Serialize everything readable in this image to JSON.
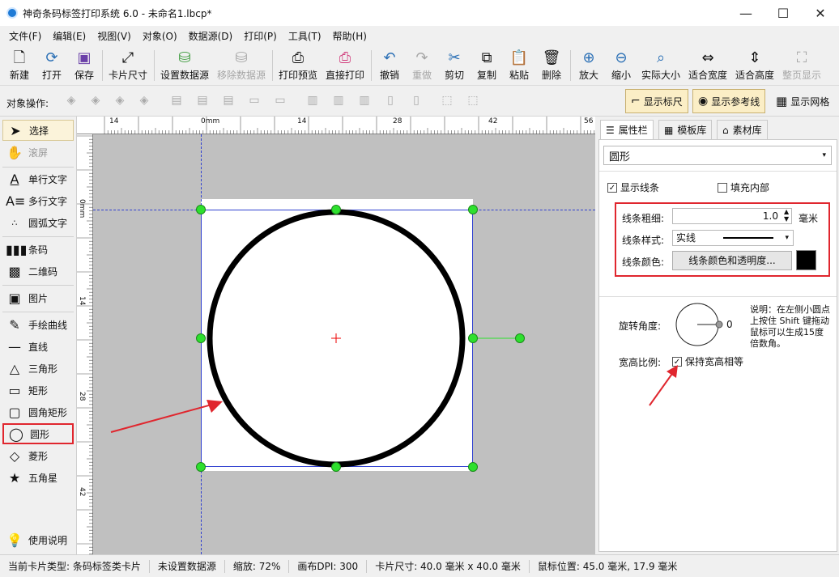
{
  "window": {
    "title": "神奇条码标签打印系统 6.0 - 未命名1.lbcp*"
  },
  "menu": [
    "文件(F)",
    "编辑(E)",
    "视图(V)",
    "对象(O)",
    "数据源(D)",
    "打印(P)",
    "工具(T)",
    "帮助(H)"
  ],
  "toolbar": {
    "new": "新建",
    "open": "打开",
    "save": "保存",
    "card_size": "卡片尺寸",
    "set_datasource": "设置数据源",
    "remove_datasource": "移除数据源",
    "print_preview": "打印预览",
    "direct_print": "直接打印",
    "undo": "撤销",
    "redo": "重做",
    "cut": "剪切",
    "copy": "复制",
    "paste": "粘贴",
    "delete": "删除",
    "zoom_in": "放大",
    "zoom_out": "缩小",
    "actual_size": "实际大小",
    "fit_width": "适合宽度",
    "fit_height": "适合高度",
    "full_page": "整页显示"
  },
  "objbar": {
    "label": "对象操作:",
    "show_ruler": "显示标尺",
    "show_guides": "显示参考线",
    "show_grid": "显示网格"
  },
  "tools": {
    "select": "选择",
    "scroll": "滚屏",
    "single_text": "单行文字",
    "multi_text": "多行文字",
    "arc_text": "圆弧文字",
    "barcode": "条码",
    "qrcode": "二维码",
    "image": "图片",
    "freehand": "手绘曲线",
    "line": "直线",
    "triangle": "三角形",
    "rect": "矩形",
    "round_rect": "圆角矩形",
    "circle": "圆形",
    "diamond": "菱形",
    "star": "五角星",
    "help": "使用说明"
  },
  "ruler": {
    "top": [
      "14",
      "0mm",
      "14",
      "28",
      "42",
      "56"
    ],
    "left": [
      "0mm",
      "14",
      "28",
      "42"
    ]
  },
  "panel": {
    "tabs": {
      "props": "属性栏",
      "templates": "模板库",
      "assets": "素材库"
    },
    "object_type": "圆形",
    "show_line": "显示线条",
    "fill_inside": "填充内部",
    "line_width_label": "线条粗细:",
    "line_width_value": "1.0",
    "line_width_unit": "毫米",
    "line_style_label": "线条样式:",
    "line_style_value": "实线",
    "line_color_label": "线条颜色:",
    "line_color_button": "线条颜色和透明度...",
    "line_color": "#000000",
    "rotation_label": "旋转角度:",
    "rotation_value": "0",
    "rotation_note": "说明：在左侧小圆点上按住 Shift 键拖动鼠标可以生成15度倍数角。",
    "aspect_label": "宽高比例:",
    "keep_aspect": "保持宽高相等"
  },
  "status": {
    "card_type": "当前卡片类型: 条码标签类卡片",
    "datasource": "未设置数据源",
    "zoom": "缩放: 72%",
    "dpi": "画布DPI: 300",
    "card_size": "卡片尺寸: 40.0 毫米 x 40.0 毫米",
    "mouse": "鼠标位置: 45.0 毫米, 17.9 毫米"
  },
  "colors": {
    "accent": "#1e7ad6",
    "highlight": "#e0262e",
    "handle": "#2ee02e"
  }
}
